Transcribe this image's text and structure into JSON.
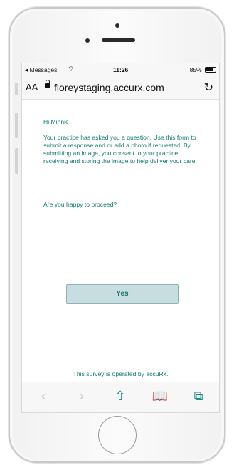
{
  "status_bar": {
    "back_app": "◂ Messages",
    "time": "11:26",
    "battery": "85%"
  },
  "browser": {
    "text_size_label": "AA",
    "url": "floreystaging.accurx.com"
  },
  "form": {
    "greeting": "Hi Minnie",
    "message": "Your practice has asked you a question. Use this form to submit a response and or add a photo if requested. By submitting an image, you consent to your practice receiving and storing the image to help deliver your care.",
    "question": "Are you happy to proceed?",
    "yes_label": "Yes"
  },
  "footer": {
    "text": "This survey is operated by ",
    "link": "accuRx."
  },
  "icons": {
    "back": "chevron-left-icon",
    "forward": "chevron-right-icon",
    "share": "share-icon",
    "bookmarks": "book-icon",
    "tabs": "tabs-icon"
  },
  "colors": {
    "text_accent": "#0f7a6c",
    "button_bg": "#c7dee0",
    "toolbar_icon": "#1a8f84"
  }
}
